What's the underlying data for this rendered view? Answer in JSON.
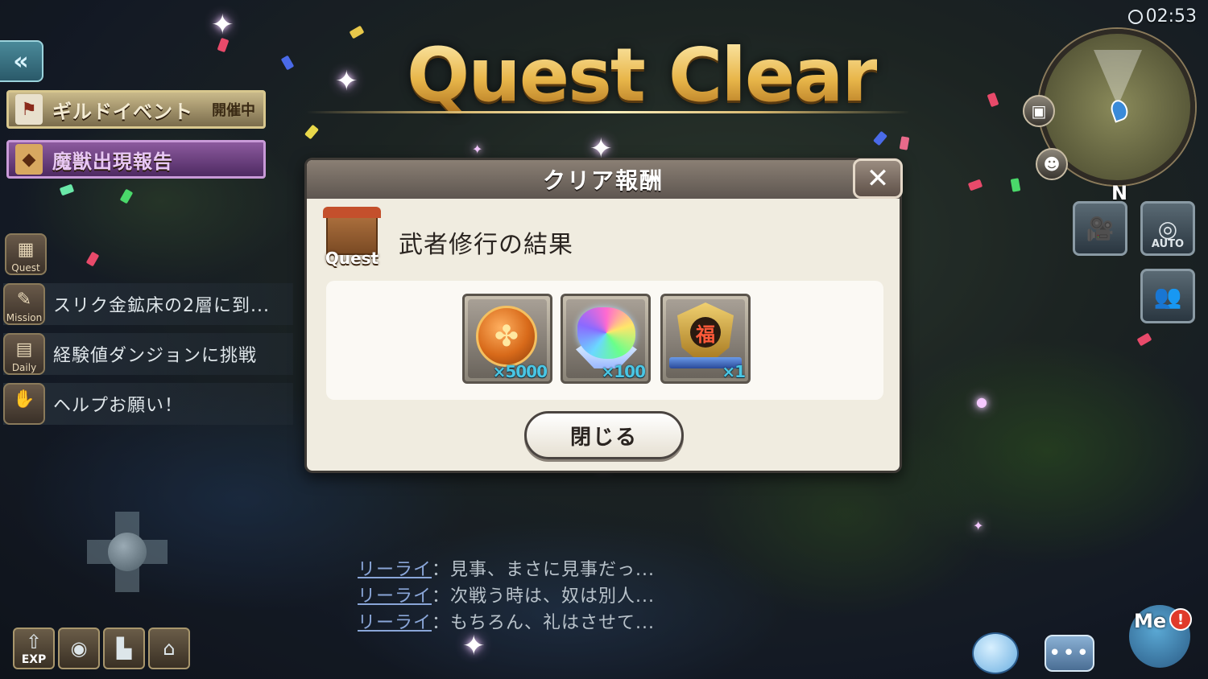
{
  "title": "Quest Clear",
  "clock": "02:53",
  "minimap": {
    "north": "N"
  },
  "left_panel": {
    "back_icon": "double-chevron-left-icon",
    "guild_event": {
      "label": "ギルドイベント",
      "status": "開催中"
    },
    "beast_report": {
      "label": "魔獣出現報告"
    },
    "quest_icon_label": "Quest",
    "tasks": [
      {
        "icon_label": "Mission",
        "text": "スリク金鉱床の2層に到..."
      },
      {
        "icon_label": "Daily",
        "text": "経験値ダンジョンに挑戦"
      },
      {
        "icon_label": "",
        "text": "ヘルプお願い！"
      }
    ]
  },
  "dialog": {
    "title": "クリア報酬",
    "quest_badge_label": "Quest",
    "quest_name": "武者修行の結果",
    "rewards": [
      {
        "icon": "gold-coin-icon",
        "qty": "×5000"
      },
      {
        "icon": "rainbow-gem-icon",
        "qty": "×100"
      },
      {
        "icon": "fortune-emblem-icon",
        "qty": "×1"
      }
    ],
    "close_label": "閉じる"
  },
  "right_panel": {
    "auto_label": "AUTO"
  },
  "bottom_bar": {
    "buttons": [
      {
        "label": "EXP"
      },
      {
        "label": ""
      },
      {
        "label": ""
      },
      {
        "label": ""
      }
    ]
  },
  "chat": [
    {
      "speaker": "リーライ",
      "text": "：見事、まさに見事だっ..."
    },
    {
      "speaker": "リーライ",
      "text": "：次戦う時は、奴は別人..."
    },
    {
      "speaker": "リーライ",
      "text": "：もちろん、礼はさせて..."
    }
  ],
  "me": {
    "label": "Me",
    "alert": "!"
  },
  "colors": {
    "title_gold": "#e8b64a",
    "dialog_bg": "#f0ece0",
    "qty_cyan": "#4ac6e4"
  }
}
